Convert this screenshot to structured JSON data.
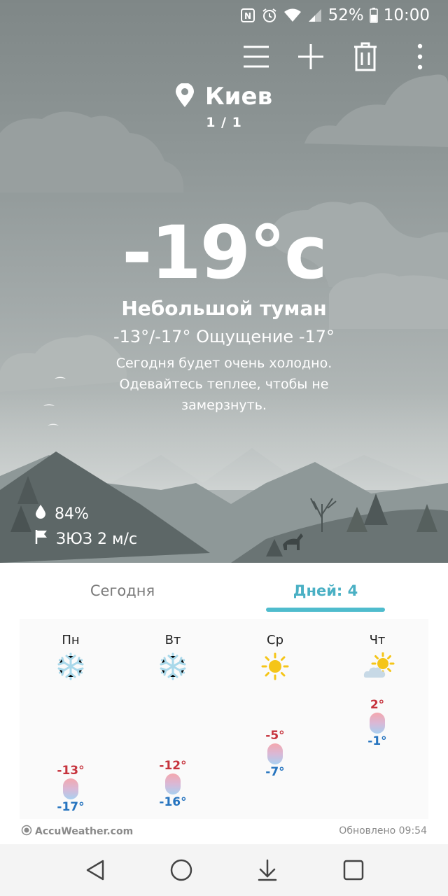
{
  "status_bar": {
    "battery": "52%",
    "time": "10:00",
    "icons": [
      "nfc-icon",
      "alarm-icon",
      "wifi-icon",
      "signal-icon",
      "battery-icon"
    ]
  },
  "toolbar": {
    "icons": [
      "list-icon",
      "add-icon",
      "delete-icon",
      "more-vert-icon"
    ]
  },
  "location": {
    "city": "Киев",
    "page": "1 / 1"
  },
  "current": {
    "temperature": "-19°c",
    "condition": "Небольшой туман",
    "range_feel": "-13°/-17° Ощущение -17°",
    "advice": "Сегодня будет очень холодно. Одевайтесь теплее, чтобы не замерзнуть.",
    "humidity": "84%",
    "wind": "ЗЮЗ 2 м/с"
  },
  "tabs": {
    "today": "Сегодня",
    "days": "Дней: 4",
    "active": "days"
  },
  "forecast": [
    {
      "day": "Пн",
      "icon": "snowflake-icon",
      "high": "-13°",
      "low": "-17°"
    },
    {
      "day": "Вт",
      "icon": "snowflake-icon",
      "high": "-12°",
      "low": "-16°"
    },
    {
      "day": "Ср",
      "icon": "sun-icon",
      "high": "-5°",
      "low": "-7°"
    },
    {
      "day": "Чт",
      "icon": "partly-cloudy-icon",
      "high": "2°",
      "low": "-1°"
    }
  ],
  "footer": {
    "provider": "AccuWeather.com",
    "updated": "Обновлено 09:54"
  },
  "colors": {
    "accent": "#4fbccd",
    "high_temp": "#c6333d",
    "low_temp": "#2674bf",
    "snow": "#a8d8ea",
    "sun": "#f5c518"
  }
}
